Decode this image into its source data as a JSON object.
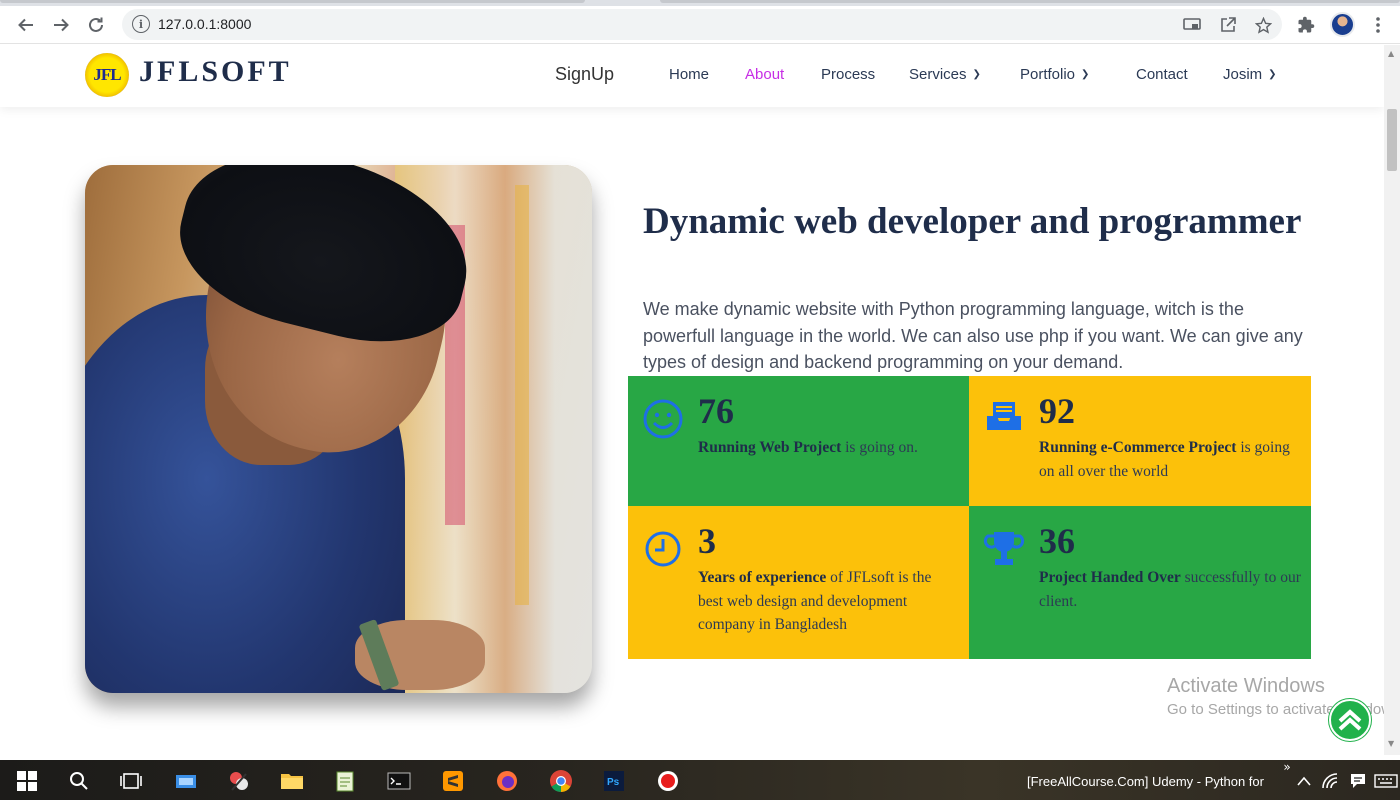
{
  "browser": {
    "url": "127.0.0.1:8000"
  },
  "site": {
    "logo_badge_text": "JFL",
    "logo_text": "JFLSOFT",
    "signup_label": "SignUp",
    "nav": [
      {
        "label": "Home",
        "active": false,
        "dropdown": false
      },
      {
        "label": "About",
        "active": true,
        "dropdown": false
      },
      {
        "label": "Process",
        "active": false,
        "dropdown": false
      },
      {
        "label": "Services",
        "active": false,
        "dropdown": true
      },
      {
        "label": "Portfolio",
        "active": false,
        "dropdown": true
      },
      {
        "label": "Contact",
        "active": false,
        "dropdown": false
      },
      {
        "label": "Josim",
        "active": false,
        "dropdown": true
      }
    ],
    "active_nav_color": "#c72ee5"
  },
  "about": {
    "heading": "Dynamic web developer and programmer",
    "paragraph": "We make dynamic website with Python programming language, witch is the powerfull language in the world. We can also use php if you want. We can give any types of design and backend programming on your demand.",
    "stats": [
      {
        "icon": "smiley-icon",
        "number": "76",
        "bold": "Running Web Project",
        "rest": " is going on.",
        "color": "#28a745"
      },
      {
        "icon": "inbox-tray-icon",
        "number": "92",
        "bold": "Running e-Commerce Project",
        "rest": " is going on all over the world",
        "color": "#fcc10a"
      },
      {
        "icon": "clock-icon",
        "number": "3",
        "bold": "Years of experience",
        "rest": " of JFLsoft is the best web design and development company in Bangladesh",
        "color": "#fcc10a"
      },
      {
        "icon": "trophy-icon",
        "number": "36",
        "bold": "Project Handed Over",
        "rest": " successfully to our client.",
        "color": "#28a745"
      }
    ]
  },
  "watermark": {
    "title": "Activate Windows",
    "subtitle": "Go to Settings to activate Windows."
  },
  "taskbar": {
    "window_title": "[FreeAllCourse.Com] Udemy - Python for"
  }
}
